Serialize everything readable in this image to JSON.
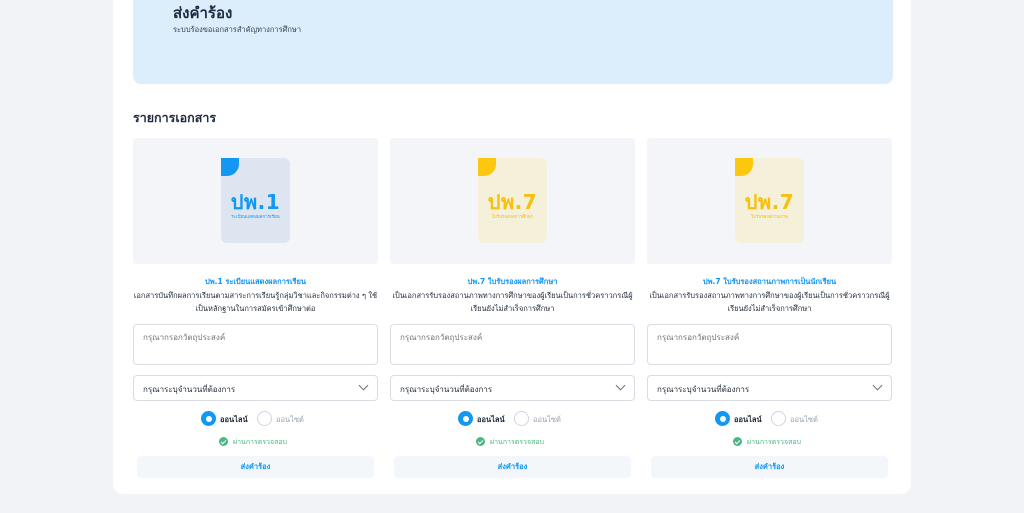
{
  "header": {
    "title": "ส่งคำร้อง",
    "subtitle": "ระบบร้องขอเอกสารสำคัญทางการศึกษา"
  },
  "section_title": "รายการเอกสาร",
  "colors": {
    "primary": "#1297f2",
    "success": "#4cb782",
    "doc_blue": "#1297f2",
    "doc_yellow": "#fcc70f",
    "banner_bg": "#dcedfb"
  },
  "documents": [
    {
      "icon_code": "ปพ.1",
      "icon_caption": "ระเบียนแสดงผลการเรียน",
      "title": "ปพ.1 ระเบียนแสดงผลการเรียน",
      "description": "เอกสารบันทึกผลการเรียนตามสาระการเรียนรู้กลุ่มวิชาและกิจกรรมต่าง ๆ ใช้เป็นหลักฐานในการสมัครเข้าศึกษาต่อ",
      "purpose_placeholder": "กรุณากรอกวัตถุประสงค์",
      "quantity_label": "กรุณาระบุจำนวนที่ต้องการ",
      "option_online": "ออนไลน์",
      "option_onsite": "ออนไซต์",
      "status": "ผ่านการตรวจสอบ",
      "submit_label": "ส่งคำร้อง"
    },
    {
      "icon_code": "ปพ.7",
      "icon_caption": "ใบรับรองผลการศึกษา",
      "title": "ปพ.7 ใบรับรองผลการศึกษา",
      "description": "เป็นเอกสารรับรองสถานภาพทางการศึกษาของผู้เรียนเป็นการชั่วคราวกรณีผู้เรียนยังไม่สำเร็จการศึกษา",
      "purpose_placeholder": "กรุณากรอกวัตถุประสงค์",
      "quantity_label": "กรุณาระบุจำนวนที่ต้องการ",
      "option_online": "ออนไลน์",
      "option_onsite": "ออนไซต์",
      "status": "ผ่านการตรวจสอบ",
      "submit_label": "ส่งคำร้อง"
    },
    {
      "icon_code": "ปพ.7",
      "icon_caption": "ใบรับรองสถานภาพ",
      "title": "ปพ.7 ใบรับรองสถานภาพการเป็นนักเรียน",
      "description": "เป็นเอกสารรับรองสถานภาพทางการศึกษาของผู้เรียนเป็นการชั่วคราวกรณีผู้เรียนยังไม่สำเร็จการศึกษา",
      "purpose_placeholder": "กรุณากรอกวัตถุประสงค์",
      "quantity_label": "กรุณาระบุจำนวนที่ต้องการ",
      "option_online": "ออนไลน์",
      "option_onsite": "ออนไซต์",
      "status": "ผ่านการตรวจสอบ",
      "submit_label": "ส่งคำร้อง"
    }
  ]
}
